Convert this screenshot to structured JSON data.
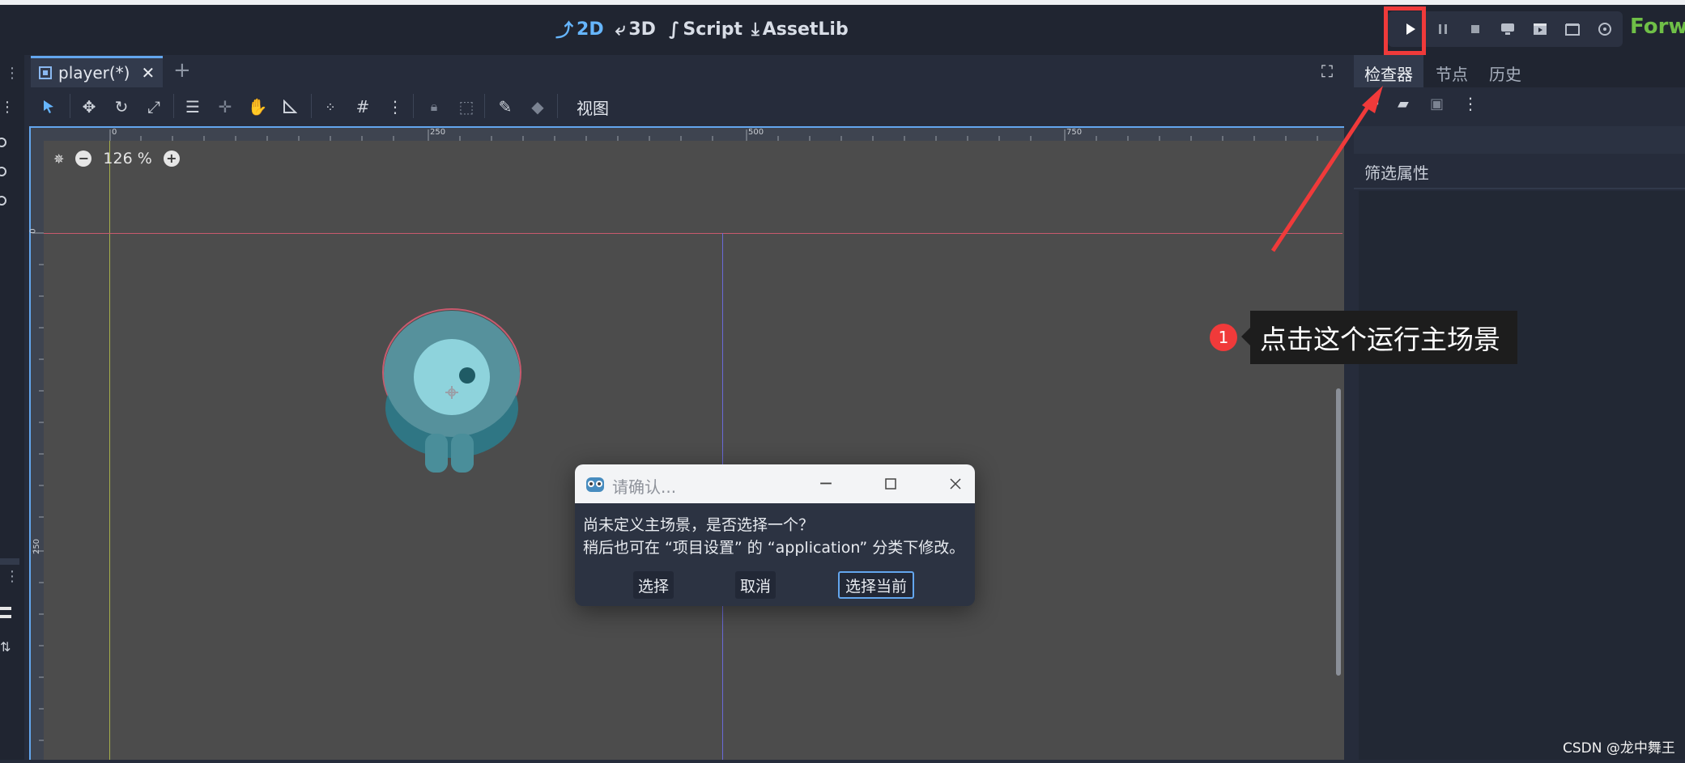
{
  "top_bar": {
    "modes": [
      {
        "icon": "2d-icon",
        "label": "2D",
        "active": true
      },
      {
        "icon": "3d-icon",
        "label": "3D",
        "active": false
      },
      {
        "icon": "script-icon",
        "label": "Script",
        "active": false
      },
      {
        "icon": "assetlib-icon",
        "label": "AssetLib",
        "active": false
      }
    ],
    "run_buttons": [
      "play-icon",
      "pause-icon",
      "stop-icon",
      "remote-debug-icon",
      "run-current-scene-icon",
      "run-custom-scene-icon",
      "movie-maker-icon"
    ],
    "renderer_label": "Forwa"
  },
  "scene_tabs": [
    {
      "label": "player(*)",
      "close_glyph": "✕"
    }
  ],
  "add_tab_glyph": "+",
  "toolbar": {
    "view_menu": "视图"
  },
  "viewport": {
    "zoom_level": "126 %",
    "ruler_top": [
      "0",
      "250",
      "500",
      "750"
    ],
    "ruler_left": [
      "0",
      "250"
    ]
  },
  "right_panel": {
    "tabs": [
      "检查器",
      "节点",
      "历史"
    ],
    "filter_label": "筛选属性"
  },
  "dialog": {
    "title": "请确认...",
    "line1": "尚未定义主场景，是否选择一个？",
    "line2": "稍后也可在 “项目设置” 的 “application” 分类下修改。",
    "buttons": {
      "select": "选择",
      "cancel": "取消",
      "select_current": "选择当前"
    }
  },
  "annotation": {
    "badge": "1",
    "text": "点击这个运行主场景"
  },
  "watermark": "CSDN @龙中舞王",
  "colors": {
    "accent": "#63a6ee",
    "highlight_red": "#f03a3a",
    "renderer_green": "#6fbf47",
    "viewport_bg": "#4c4c4c"
  }
}
